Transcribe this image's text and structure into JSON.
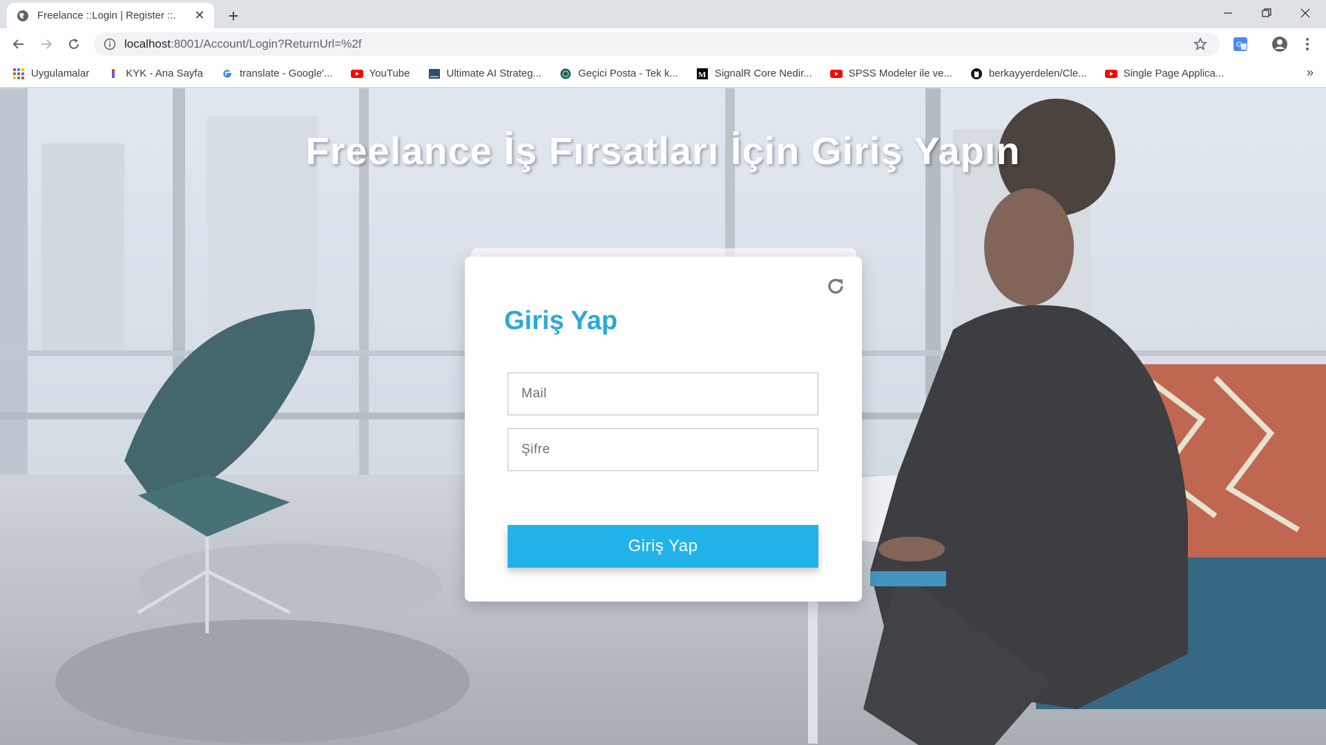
{
  "browser": {
    "tab": {
      "title": "Freelance ::Login | Register ::.",
      "favicon": "globe-icon"
    },
    "address": {
      "host": "localhost",
      "path": ":8001/Account/Login?ReturnUrl=%2f"
    },
    "bookmarks": [
      {
        "label": "Uygulamalar",
        "icon": "apps-grid-icon"
      },
      {
        "label": "KYK - Ana Sayfa",
        "icon": "kyk-icon"
      },
      {
        "label": "translate - Google'...",
        "icon": "google-icon"
      },
      {
        "label": "YouTube",
        "icon": "youtube-icon"
      },
      {
        "label": "Ultimate AI Strateg...",
        "icon": "page-icon"
      },
      {
        "label": "Geçici Posta - Tek k...",
        "icon": "mail-icon"
      },
      {
        "label": "SignalR Core Nedir...",
        "icon": "medium-icon"
      },
      {
        "label": "SPSS Modeler ile ve...",
        "icon": "youtube-icon"
      },
      {
        "label": "berkayyerdelen/Cle...",
        "icon": "github-icon"
      },
      {
        "label": "Single Page Applica...",
        "icon": "youtube-icon"
      }
    ],
    "more": "»"
  },
  "page": {
    "hero_title": "Freelance İş Fırsatları İçin Giriş Yapın",
    "login": {
      "title": "Giriş Yap",
      "mail_placeholder": "Mail",
      "password_placeholder": "Şifre",
      "submit_label": "Giriş Yap"
    }
  },
  "colors": {
    "accent": "#29a9d8",
    "button": "#22b2ea"
  }
}
